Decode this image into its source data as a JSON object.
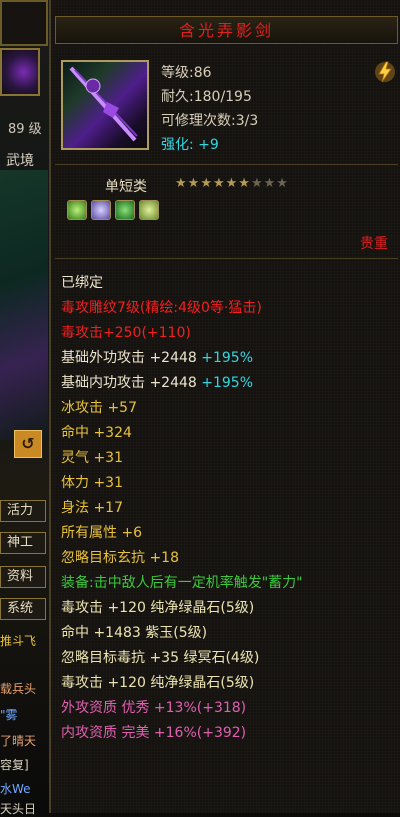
{
  "left": {
    "level_label": "89 级",
    "wujing": "武境",
    "return_icon": "return-icon",
    "buttons": [
      "活力",
      "神工",
      "资料",
      "系统"
    ],
    "chat": [
      {
        "text": "推斗飞",
        "color": "#e8c23a"
      },
      {
        "text": "载兵头",
        "color": "#e8a070"
      },
      {
        "text": "\"雾",
        "color": "#6fa8ff"
      },
      {
        "text": "了晴天",
        "color": "#e8a070"
      },
      {
        "text": "容复]",
        "color": "#d9d2bf"
      },
      {
        "text": "水We",
        "color": "#6fa8ff"
      },
      {
        "text": "天头日",
        "color": "#d9d2bf"
      }
    ]
  },
  "item": {
    "name": "含光弄影剑",
    "icon": "sword-icon",
    "level": "等级:86",
    "durability": "耐久:180/195",
    "repairs": "可修理次数:3/3",
    "enhance_label": "强化:",
    "enhance_value": "+9",
    "bolt_icon": "lightning-icon",
    "category": "单短类",
    "stars_total": 9,
    "stars_filled": 6,
    "gems": [
      "#7ad04a",
      "#9a8ad0",
      "#3aa83a",
      "#b0d060"
    ],
    "rarity": "贵重"
  },
  "props": {
    "bound": "已绑定",
    "engrave": "毒攻雕纹7级(精绘:4级0等·猛击)",
    "poison_atk": "毒攻击+250(+110)",
    "base_outer_label": "基础外功攻击 +2448",
    "base_outer_pct": "+195%",
    "base_inner_label": "基础内功攻击 +2448",
    "base_inner_pct": "+195%",
    "ice_atk": "冰攻击 +57",
    "hit": "命中 +324",
    "spirit": "灵气 +31",
    "stamina": "体力 +31",
    "agility": "身法 +17",
    "all_attrs": "所有属性 +6",
    "ignore_xuan": "忽略目标玄抗 +18",
    "equip_effect": "装备:击中敌人后有一定机率触发\"蓄力\"",
    "gem1": "毒攻击 +120 纯净绿晶石(5级)",
    "gem2": "命中 +1483 紫玉(5级)",
    "gem3": "忽略目标毒抗 +35 绿冥石(4级)",
    "gem4": "毒攻击 +120 纯净绿晶石(5级)",
    "outer_quality": "外攻资质  优秀 +13%(+318)",
    "inner_quality": "内攻资质  完美 +16%(+392)"
  }
}
